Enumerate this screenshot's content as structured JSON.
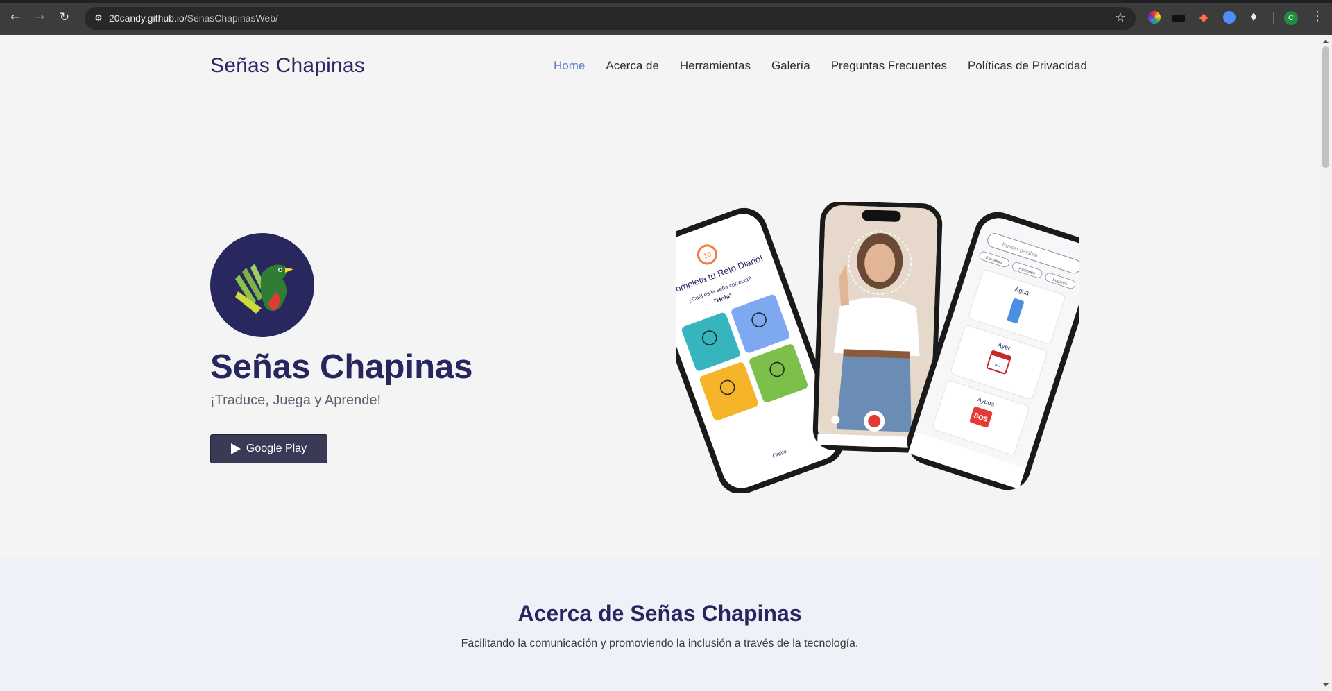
{
  "browser": {
    "url_host": "20candy.github.io",
    "url_path": "/SenasChapinasWeb/",
    "profile_initial": "C",
    "icons": [
      "back-icon",
      "forward-icon",
      "reload-icon",
      "site-info-icon",
      "bookmark-star-icon",
      "extensions-icon",
      "menu-icon"
    ]
  },
  "header": {
    "brand": "Señas Chapinas",
    "nav": [
      {
        "label": "Home",
        "active": true
      },
      {
        "label": "Acerca de",
        "active": false
      },
      {
        "label": "Herramientas",
        "active": false
      },
      {
        "label": "Galería",
        "active": false
      },
      {
        "label": "Preguntas Frecuentes",
        "active": false
      },
      {
        "label": "Políticas de Privacidad",
        "active": false
      }
    ]
  },
  "hero": {
    "title": "Señas Chapinas",
    "subtitle": "¡Traduce, Juega y Aprende!",
    "button_label": "Google Play",
    "phones": {
      "left": {
        "streak": "10",
        "heading": "¡Completa tu Reto Diario!",
        "question": "¿Cuál es la seña correcta?",
        "word": "\"Hola\"",
        "skip": "Omitir"
      },
      "right": {
        "search_placeholder": "Buscar palabra",
        "chips": [
          "Favoritos",
          "Acciones",
          "Lugares"
        ],
        "cards": [
          "Agua",
          "Ayer",
          "Ayuda"
        ],
        "sos": "SOS"
      }
    }
  },
  "about": {
    "title": "Acerca de Señas Chapinas",
    "subtitle": "Facilitando la comunicación y promoviendo la inclusión a través de la tecnología."
  },
  "colors": {
    "brand_navy": "#27265f",
    "nav_active": "#5b7ed0",
    "button_bg": "#3a3a57",
    "about_bg": "#eef2f8"
  }
}
